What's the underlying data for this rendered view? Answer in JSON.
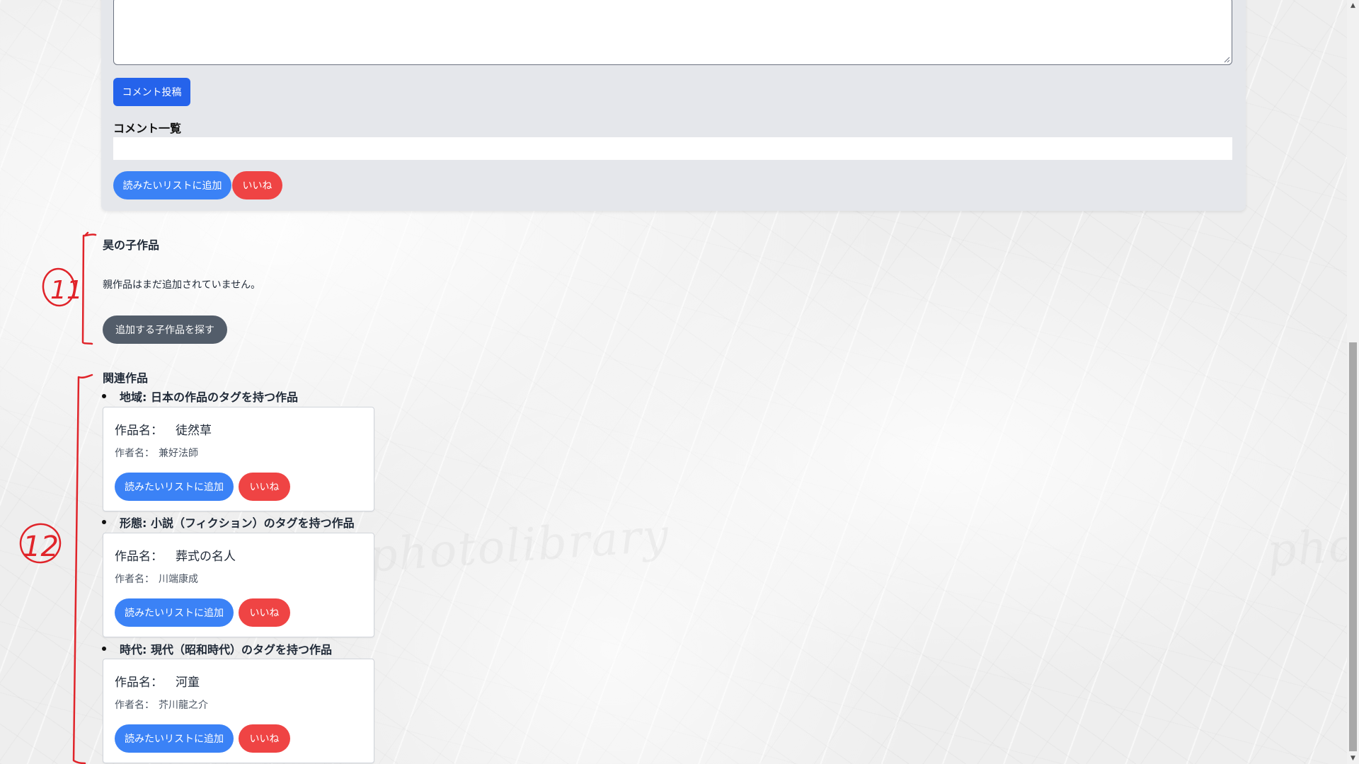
{
  "comment_form": {
    "post_button": "コメント投稿",
    "list_heading": "コメント一覧"
  },
  "main_actions": {
    "add_to_list": "読みたいリストに追加",
    "like": "いいね"
  },
  "child_works": {
    "heading": "昊の子作品",
    "empty_message": "親作品はまだ追加されていません。",
    "find_button": "追加する子作品を探す"
  },
  "related_works": {
    "heading": "関連作品",
    "groups": [
      {
        "label": "地域: 日本の作品のタグを持つ作品",
        "work": {
          "title_label": "作品名：",
          "title": "徒然草",
          "author_label": "作者名：",
          "author": "兼好法師",
          "add_button": "読みたいリストに追加",
          "like_button": "いいね"
        }
      },
      {
        "label": "形態: 小説（フィクション）のタグを持つ作品",
        "work": {
          "title_label": "作品名：",
          "title": "葬式の名人",
          "author_label": "作者名：",
          "author": "川端康成",
          "add_button": "読みたいリストに追加",
          "like_button": "いいね"
        }
      },
      {
        "label": "時代: 現代（昭和時代）のタグを持つ作品",
        "work": {
          "title_label": "作品名：",
          "title": "河童",
          "author_label": "作者名：",
          "author": "芥川龍之介",
          "add_button": "読みたいリストに追加",
          "like_button": "いいね"
        }
      }
    ]
  },
  "annotations": {
    "marker_11": "11",
    "marker_12": "12",
    "color": "#e0242a"
  },
  "watermark": {
    "text": "photolibrary"
  },
  "colors": {
    "primary_blue": "#2563eb",
    "pill_blue": "#3b82f6",
    "like_red": "#ef4444",
    "gray_button": "#4b5563",
    "panel_gray": "#e5e7eb"
  }
}
